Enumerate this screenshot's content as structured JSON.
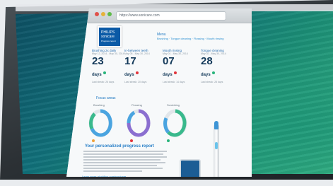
{
  "browser": {
    "url": "https://www.sonicare.com"
  },
  "brand": {
    "line1": "PHILIPS",
    "line2": "sonicare",
    "line3": "Progress report"
  },
  "menu": {
    "label": "Menu",
    "nav": "Brushing · Tongue cleaning · Flossing · Mouth rinsing"
  },
  "stats": [
    {
      "label": "Brushing 2x daily",
      "sub": "May 12, 2014 - May 30, 2014",
      "value": "23",
      "unit": "days",
      "last": "Last streak: 26 days",
      "status": "good"
    },
    {
      "label": "In-between teeth",
      "sub": "May 05 - May 30, 2014",
      "value": "17",
      "unit": "days",
      "last": "Last streak: 20 days",
      "status": "bad"
    },
    {
      "label": "Mouth rinsing",
      "sub": "May 01 - May 30, 2014",
      "value": "07",
      "unit": "days",
      "last": "Last streak: 14 days",
      "status": "bad"
    },
    {
      "label": "Tongue cleaning",
      "sub": "May 02 - May 30, 2014",
      "value": "28",
      "unit": "days",
      "last": "Last streak: 28 days",
      "status": "good"
    }
  ],
  "focus": {
    "title": "Focus areas",
    "rings": [
      {
        "label": "Brushing",
        "fill": 0.85
      },
      {
        "label": "Flossing",
        "fill": 0.7
      },
      {
        "label": "Scrubbing",
        "fill": 0.6
      }
    ]
  },
  "report": {
    "title": "Your personalized progress report",
    "cta": "Learn more at philips.com/sonicare"
  },
  "colors": {
    "good": "#28b47b",
    "bad": "#e2343b",
    "ring_blue": "#4aa4e0",
    "ring_purple": "#8b6fd0",
    "ring_green": "#39b98c",
    "ring_orange": "#f0a23b"
  }
}
